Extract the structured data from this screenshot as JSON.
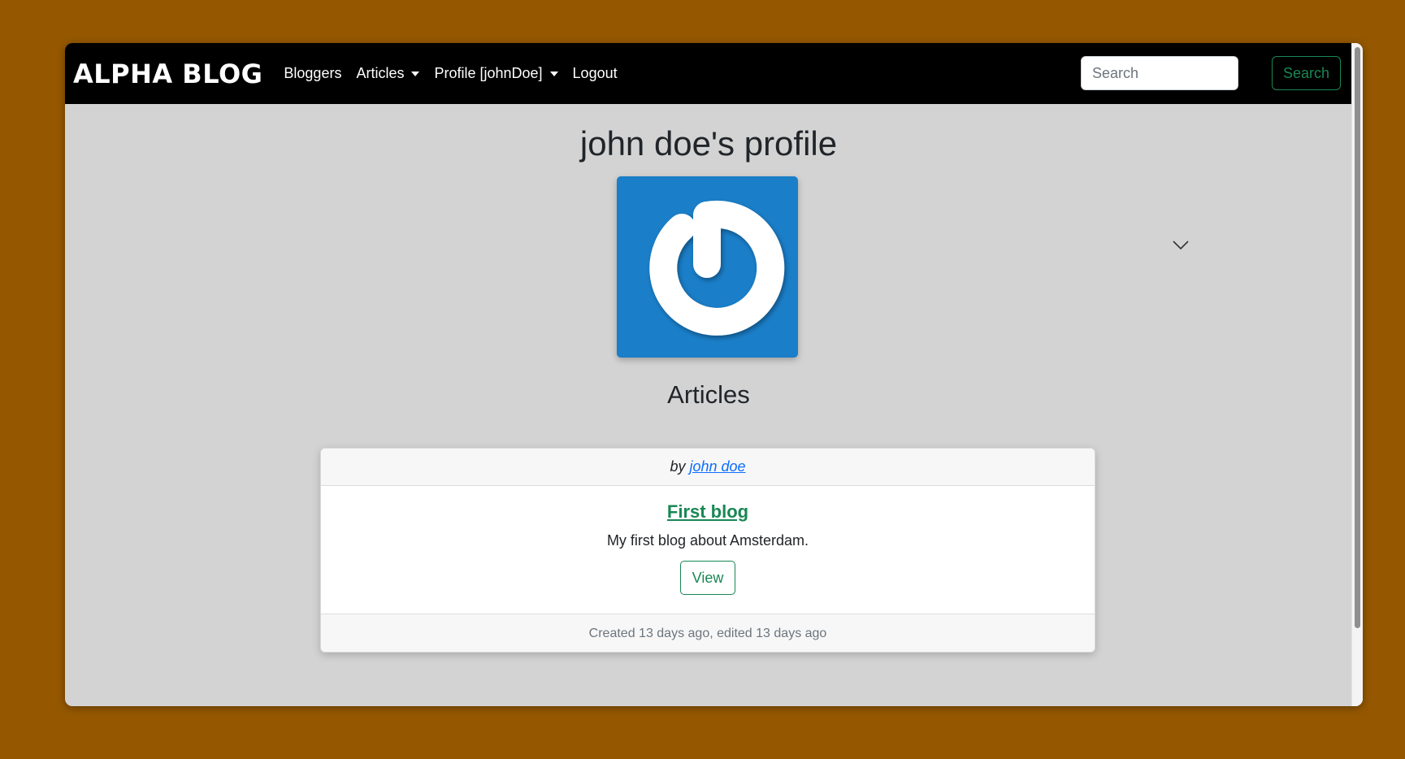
{
  "navbar": {
    "brand": "ALPHA BLOG",
    "items": [
      {
        "label": "Bloggers",
        "dropdown": false
      },
      {
        "label": "Articles",
        "dropdown": true
      },
      {
        "label": "Profile [johnDoe]",
        "dropdown": true
      },
      {
        "label": "Logout",
        "dropdown": false
      }
    ],
    "search": {
      "placeholder": "Search",
      "value": "",
      "button_label": "Search"
    }
  },
  "profile": {
    "title": "john doe's profile",
    "avatar_icon": "gravatar-power-logo-icon"
  },
  "articles_section": {
    "title": "Articles"
  },
  "article": {
    "byline_prefix": "by",
    "author": "john doe",
    "title": "First blog",
    "description": "My first blog about Amsterdam.",
    "view_label": "View",
    "footer": "Created 13 days ago, edited 13 days ago"
  },
  "colors": {
    "page_background": "#955800",
    "navbar": "#000000",
    "content_background": "#d3d3d3",
    "accent_green": "#198754",
    "link_blue": "#0d6efd",
    "avatar_blue": "#1a7ec8"
  }
}
